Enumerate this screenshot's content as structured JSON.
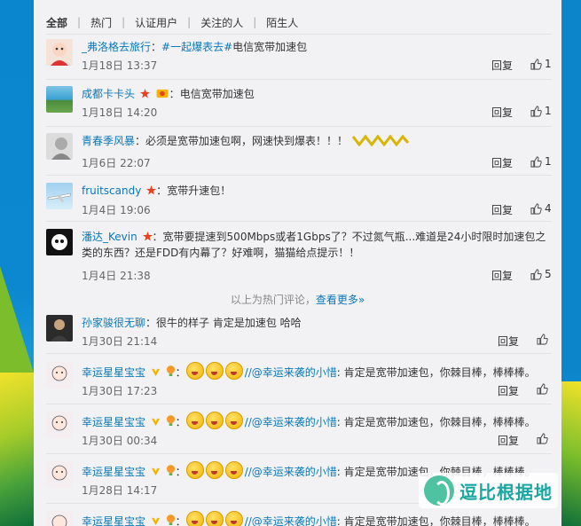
{
  "tabs": [
    "全部",
    "热门",
    "认证用户",
    "关注的人",
    "陌生人"
  ],
  "hot_note": {
    "text": "以上为热门评论，",
    "link": "查看更多»"
  },
  "comments": [
    {
      "user": "_弗洛格去旅行",
      "text_prefix": "：",
      "mention": "#一起爆表去#",
      "text": "电信宽带加速包",
      "time": "1月18日 13:37",
      "reply": "回复",
      "likes": "1"
    },
    {
      "user": "成都卡卡头",
      "text_prefix": "：",
      "mention": "",
      "text": "电信宽带加速包",
      "time": "1月18日 14:20",
      "reply": "回复",
      "likes": "1"
    },
    {
      "user": "青春季风暴",
      "text_prefix": "：",
      "mention": "",
      "text": "必须是宽带加速包啊，网速快到爆表！！！",
      "time": "1月6日 22:07",
      "reply": "回复",
      "likes": "1"
    },
    {
      "user": "fruitscandy",
      "text_prefix": "：",
      "mention": "",
      "text": "宽带升速包！",
      "time": "1月4日 19:06",
      "reply": "回复",
      "likes": "4"
    },
    {
      "user": "潘达_Kevin",
      "text_prefix": "：",
      "mention": "",
      "text": "宽带要提速到500Mbps或者1Gbps了？不过氮气瓶...难道是24小时限时加速包之类的东西？还是FDD有内幕了？好难啊，猫猫给点提示！！",
      "time": "1月4日 21:38",
      "reply": "回复",
      "likes": "5"
    },
    {
      "user": "孙家骏很无聊",
      "text_prefix": "：",
      "mention": "",
      "text": "很牛的样子 肯定是加速包 哈哈",
      "time": "1月30日 21:14",
      "reply": "回复",
      "likes": ""
    },
    {
      "user": "幸运星星宝宝",
      "text_prefix": "：",
      "mention": "//@幸运来袭的小惜",
      "text": ": 肯定是宽带加速包，你棘目棒，棒棒棒。",
      "time": "1月30日 17:23",
      "reply": "回复",
      "likes": ""
    },
    {
      "user": "幸运星星宝宝",
      "text_prefix": "：",
      "mention": "//@幸运来袭的小惜",
      "text": ": 肯定是宽带加速包，你棘目棒，棒棒棒。",
      "time": "1月30日 00:34",
      "reply": "回复",
      "likes": ""
    },
    {
      "user": "幸运星星宝宝",
      "text_prefix": "：",
      "mention": "//@幸运来袭的小惜",
      "text": ": 肯定是宽带加速包，你棘目棒，棒棒棒。",
      "time": "1月28日 14:17",
      "reply": "回复",
      "likes": ""
    },
    {
      "user": "幸运星星宝宝",
      "text_prefix": "：",
      "mention": "//@幸运来袭的小惜",
      "text": ": 肯定是宽带加速包，你棘目棒，棒棒棒。",
      "time": "",
      "reply": "",
      "likes": ""
    }
  ],
  "watermark": "逗比根据地",
  "colors": {
    "link": "#0a78b8",
    "panel": "#f2f2f5",
    "background": "#0e7fc3"
  }
}
